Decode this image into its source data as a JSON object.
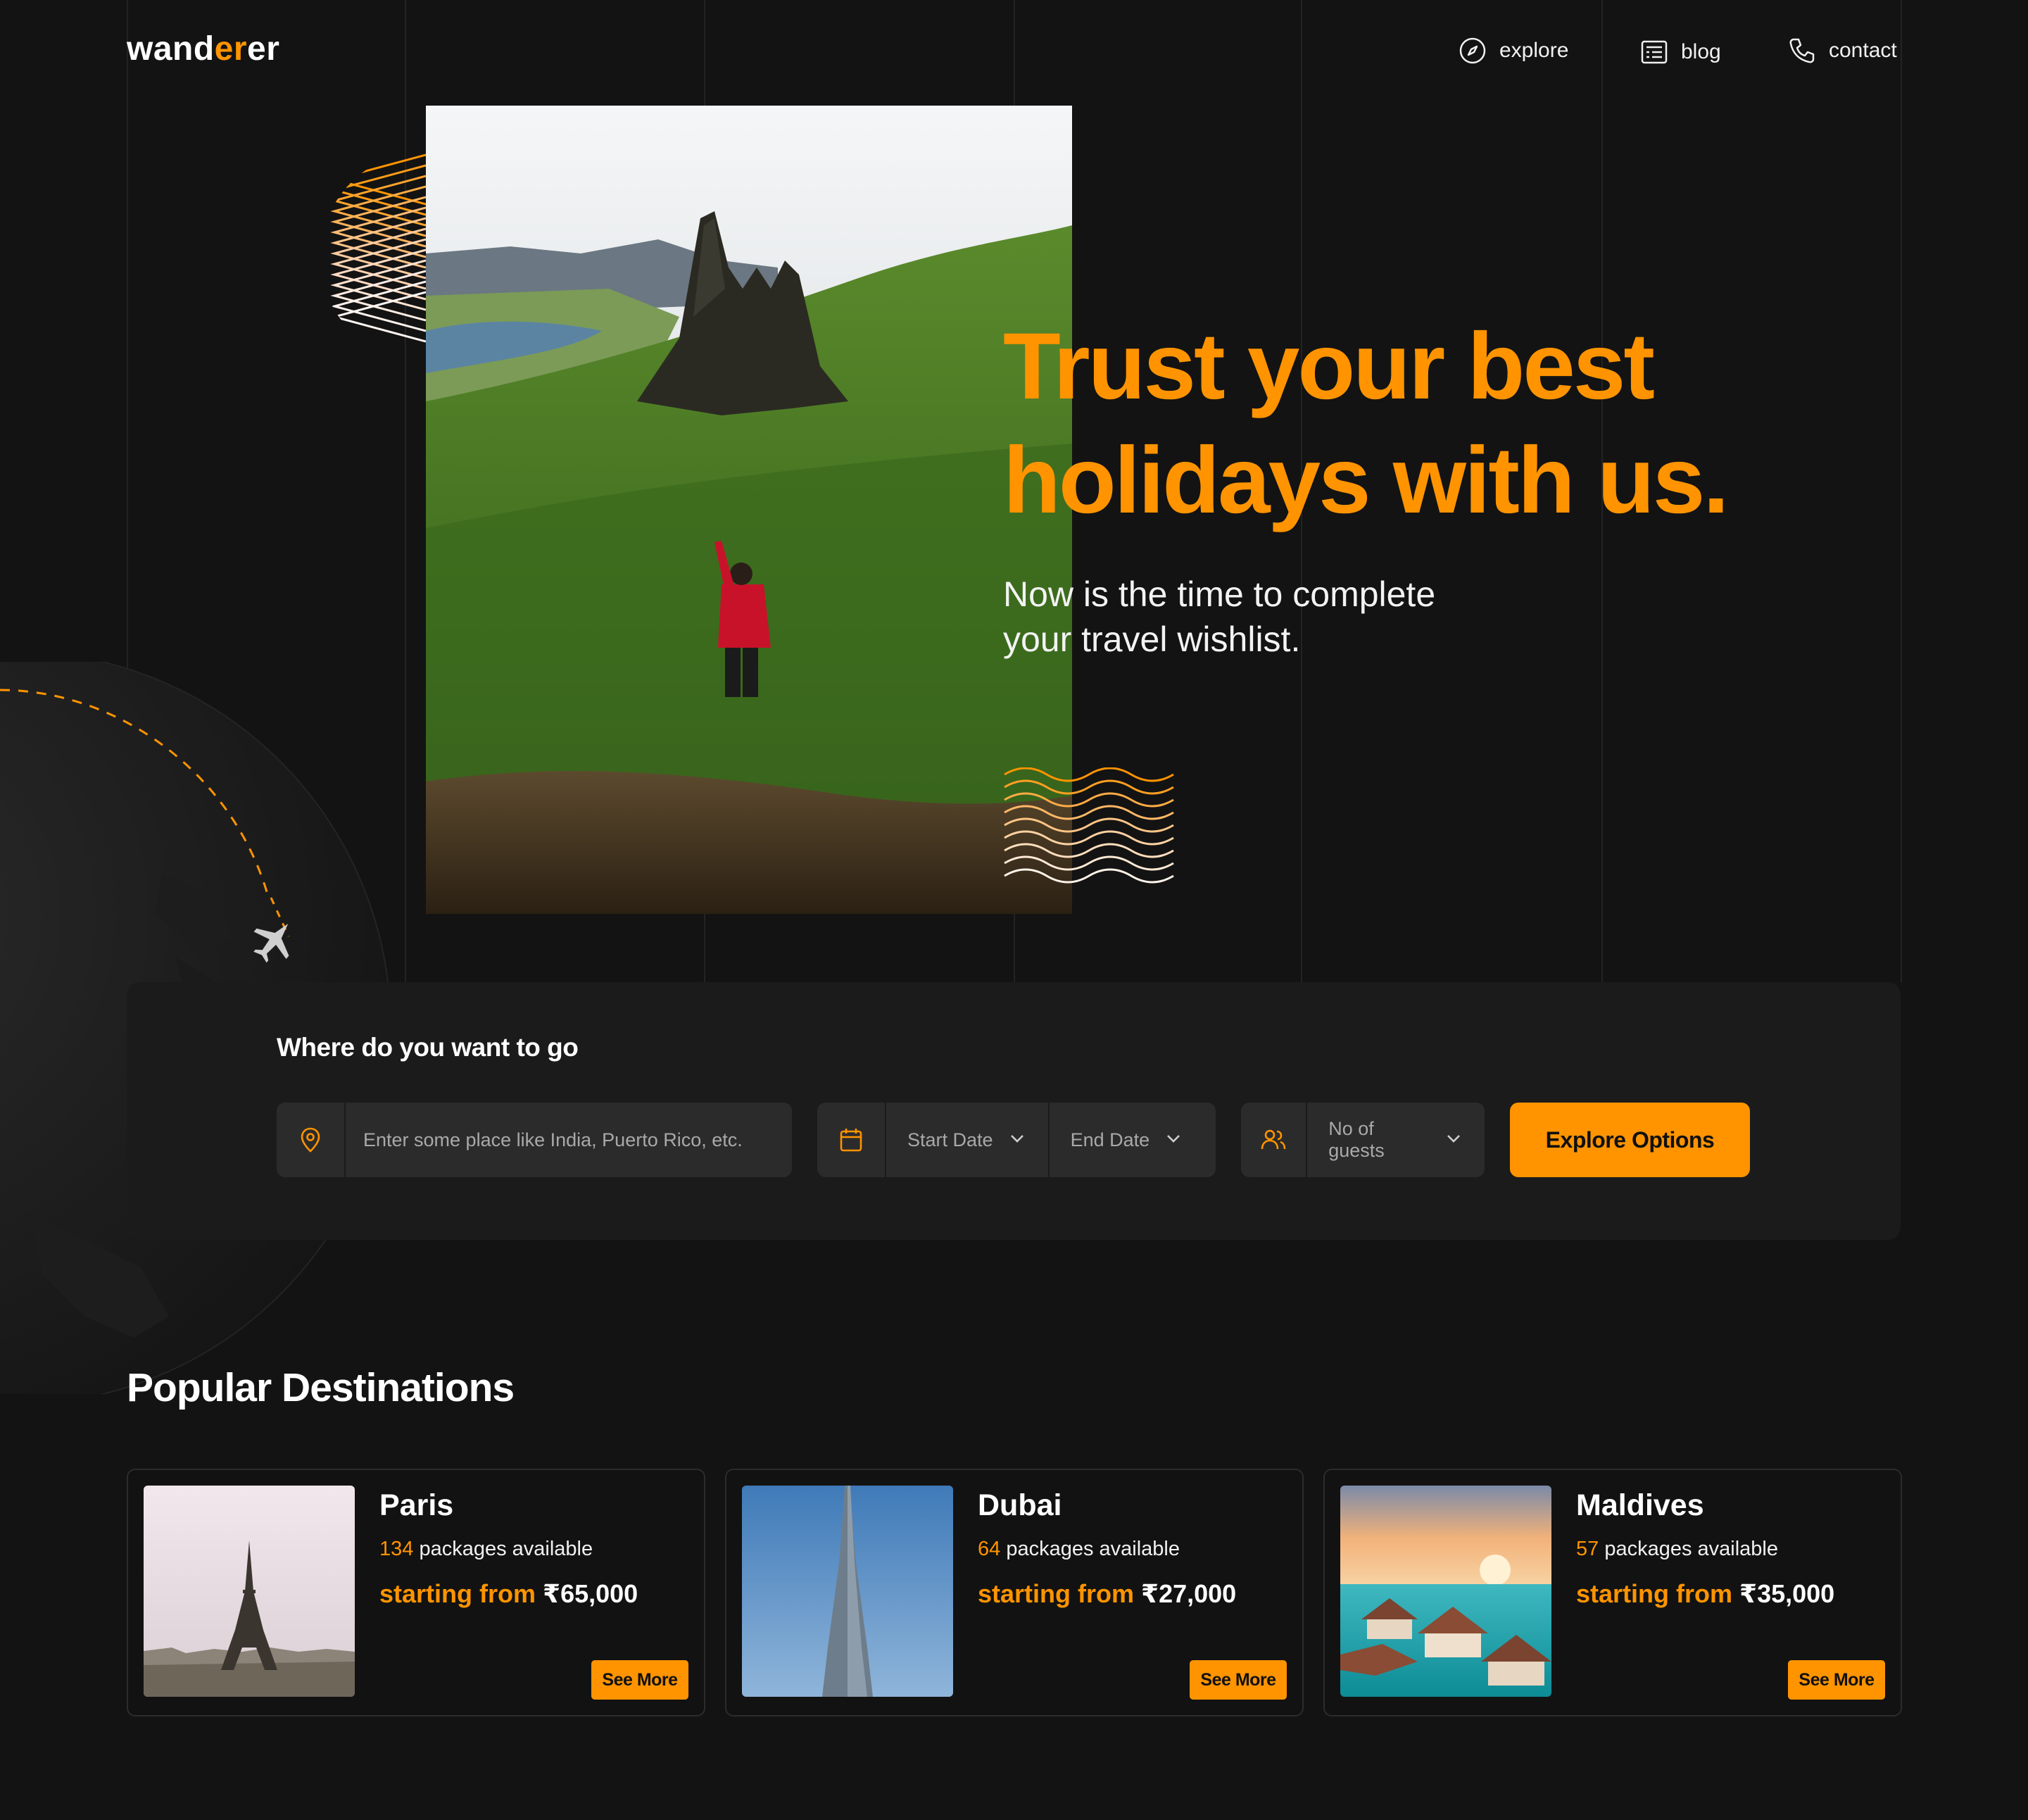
{
  "brand": {
    "logo_part1": "wand",
    "logo_part2": "er",
    "logo_part3": "er"
  },
  "nav": [
    {
      "label": "explore",
      "icon": "compass-icon"
    },
    {
      "label": "blog",
      "icon": "newspaper-icon"
    },
    {
      "label": "contact",
      "icon": "phone-icon"
    }
  ],
  "hero": {
    "headline_line1": "Trust your best",
    "headline_line2": "holidays with us.",
    "sub_line1": "Now is the time to complete",
    "sub_line2": "your travel wishlist."
  },
  "search": {
    "title": "Where do you want to go",
    "place_placeholder": "Enter some place like India, Puerto Rico, etc.",
    "start_date": "Start Date",
    "end_date": "End Date",
    "guests": "No of guests",
    "button": "Explore Options"
  },
  "popular": {
    "title": "Popular Destinations",
    "cards": [
      {
        "name": "Paris",
        "packages_count": "134",
        "packages_text": " packages available",
        "price_prefix": "starting from ",
        "price": "₹65,000",
        "button": "See More"
      },
      {
        "name": "Dubai",
        "packages_count": "64",
        "packages_text": " packages available",
        "price_prefix": "starting from ",
        "price": "₹27,000",
        "button": "See More"
      },
      {
        "name": "Maldives",
        "packages_count": "57",
        "packages_text": " packages available",
        "price_prefix": "starting from ",
        "price": "₹35,000",
        "button": "See More"
      }
    ]
  },
  "colors": {
    "accent": "#ff9400",
    "background": "#131313",
    "panel": "#1b1b1b",
    "field": "#2b2b2b"
  }
}
